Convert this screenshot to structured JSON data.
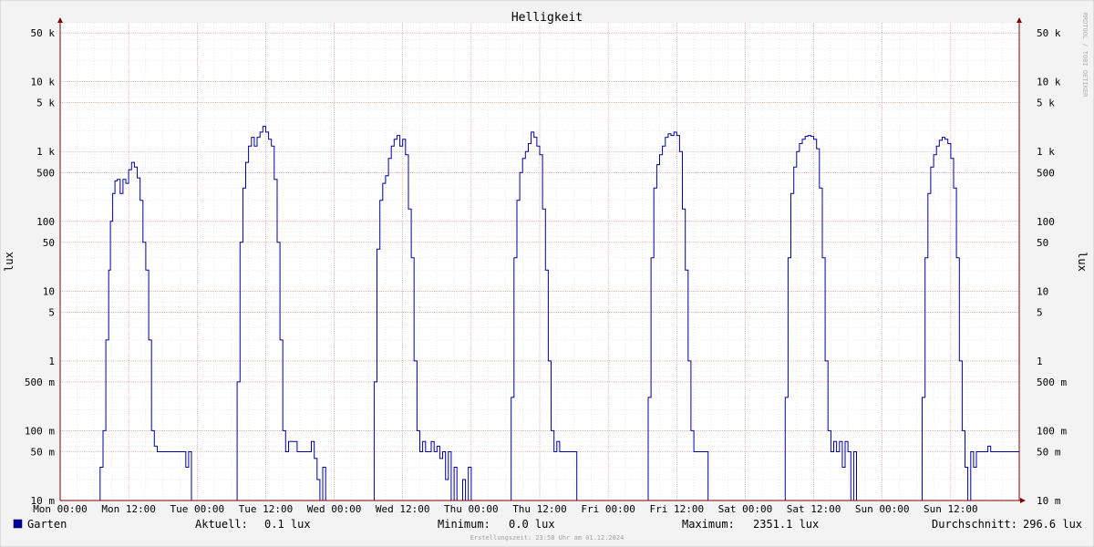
{
  "chart_data": {
    "type": "line",
    "title": "Helligkeit",
    "ylabel": "lux",
    "ylabel_right": "lux",
    "y_scale": "log",
    "ylim": [
      0.01,
      70000
    ],
    "y_ticks": [
      {
        "value": 0.01,
        "label": "10 m"
      },
      {
        "value": 0.05,
        "label": "50 m"
      },
      {
        "value": 0.1,
        "label": "100 m"
      },
      {
        "value": 0.5,
        "label": "500 m"
      },
      {
        "value": 1,
        "label": "1"
      },
      {
        "value": 5,
        "label": "5"
      },
      {
        "value": 10,
        "label": "10"
      },
      {
        "value": 50,
        "label": "50"
      },
      {
        "value": 100,
        "label": "100"
      },
      {
        "value": 500,
        "label": "500"
      },
      {
        "value": 1000,
        "label": "1 k"
      },
      {
        "value": 5000,
        "label": "5 k"
      },
      {
        "value": 10000,
        "label": "10 k"
      },
      {
        "value": 50000,
        "label": "50 k"
      }
    ],
    "x_ticks": [
      "Mon 00:00",
      "Mon 12:00",
      "Tue 00:00",
      "Tue 12:00",
      "Wed 00:00",
      "Wed 12:00",
      "Thu 00:00",
      "Thu 12:00",
      "Fri 00:00",
      "Fri 12:00",
      "Sat 00:00",
      "Sat 12:00",
      "Sun 00:00",
      "Sun 12:00"
    ],
    "x_unit": "hours since Mon 00:00",
    "xlim": [
      0,
      168
    ],
    "grid": true,
    "series": [
      {
        "name": "Garten",
        "color": "#0000a0",
        "points": [
          [
            0,
            0.01
          ],
          [
            6.5,
            0.01
          ],
          [
            7,
            0.03
          ],
          [
            7.5,
            0.1
          ],
          [
            8,
            2
          ],
          [
            8.5,
            20
          ],
          [
            8.8,
            100
          ],
          [
            9.2,
            250
          ],
          [
            9.6,
            380
          ],
          [
            10,
            400
          ],
          [
            10.5,
            250
          ],
          [
            11,
            400
          ],
          [
            11.5,
            350
          ],
          [
            12,
            550
          ],
          [
            12.5,
            700
          ],
          [
            13,
            600
          ],
          [
            13.5,
            420
          ],
          [
            14,
            200
          ],
          [
            14.5,
            50
          ],
          [
            15,
            20
          ],
          [
            15.5,
            2
          ],
          [
            16,
            0.1
          ],
          [
            16.5,
            0.06
          ],
          [
            17,
            0.05
          ],
          [
            18,
            0.05
          ],
          [
            19,
            0.05
          ],
          [
            20,
            0.05
          ],
          [
            21.5,
            0.05
          ],
          [
            22,
            0.03
          ],
          [
            22.5,
            0.05
          ],
          [
            23,
            0.01
          ],
          [
            24,
            0.01
          ],
          [
            30.5,
            0.01
          ],
          [
            31,
            0.5
          ],
          [
            31.5,
            50
          ],
          [
            32,
            300
          ],
          [
            32.5,
            700
          ],
          [
            33,
            1200
          ],
          [
            33.5,
            1600
          ],
          [
            34,
            1200
          ],
          [
            34.5,
            1600
          ],
          [
            35,
            1900
          ],
          [
            35.5,
            2300
          ],
          [
            36,
            1900
          ],
          [
            36.5,
            1500
          ],
          [
            37,
            1200
          ],
          [
            37.5,
            400
          ],
          [
            38,
            50
          ],
          [
            38.5,
            2
          ],
          [
            39,
            0.1
          ],
          [
            39.5,
            0.05
          ],
          [
            40,
            0.07
          ],
          [
            41,
            0.07
          ],
          [
            41.5,
            0.05
          ],
          [
            43,
            0.05
          ],
          [
            44,
            0.07
          ],
          [
            44.5,
            0.04
          ],
          [
            45,
            0.02
          ],
          [
            45.5,
            0.01
          ],
          [
            46,
            0.03
          ],
          [
            46.5,
            0.01
          ],
          [
            48,
            0.01
          ],
          [
            54.5,
            0.01
          ],
          [
            55,
            0.5
          ],
          [
            55.5,
            40
          ],
          [
            56,
            200
          ],
          [
            56.5,
            350
          ],
          [
            57,
            450
          ],
          [
            57.5,
            800
          ],
          [
            58,
            1200
          ],
          [
            58.5,
            1500
          ],
          [
            59,
            1700
          ],
          [
            59.5,
            1200
          ],
          [
            60,
            1500
          ],
          [
            60.5,
            900
          ],
          [
            61,
            150
          ],
          [
            61.5,
            30
          ],
          [
            62,
            1
          ],
          [
            62.5,
            0.1
          ],
          [
            63,
            0.05
          ],
          [
            63.5,
            0.07
          ],
          [
            64,
            0.05
          ],
          [
            65,
            0.07
          ],
          [
            65.5,
            0.05
          ],
          [
            66,
            0.06
          ],
          [
            66.5,
            0.04
          ],
          [
            67,
            0.05
          ],
          [
            67.5,
            0.02
          ],
          [
            68,
            0.05
          ],
          [
            68.5,
            0.01
          ],
          [
            69,
            0.03
          ],
          [
            69.5,
            0.01
          ],
          [
            70.5,
            0.02
          ],
          [
            71,
            0.01
          ],
          [
            71.5,
            0.03
          ],
          [
            72,
            0.01
          ],
          [
            78.5,
            0.01
          ],
          [
            79,
            0.3
          ],
          [
            79.5,
            30
          ],
          [
            80,
            200
          ],
          [
            80.5,
            500
          ],
          [
            81,
            800
          ],
          [
            81.5,
            1000
          ],
          [
            82,
            1300
          ],
          [
            82.5,
            1900
          ],
          [
            83,
            1600
          ],
          [
            83.5,
            1200
          ],
          [
            84,
            900
          ],
          [
            84.5,
            150
          ],
          [
            85,
            20
          ],
          [
            85.5,
            1
          ],
          [
            86,
            0.1
          ],
          [
            86.5,
            0.05
          ],
          [
            87,
            0.07
          ],
          [
            87.5,
            0.05
          ],
          [
            88,
            0.05
          ],
          [
            89,
            0.05
          ],
          [
            90,
            0.05
          ],
          [
            90.5,
            0.01
          ],
          [
            96,
            0.01
          ],
          [
            102.5,
            0.01
          ],
          [
            103,
            0.3
          ],
          [
            103.5,
            30
          ],
          [
            104,
            300
          ],
          [
            104.5,
            650
          ],
          [
            105,
            900
          ],
          [
            105.5,
            1200
          ],
          [
            106,
            1600
          ],
          [
            106.5,
            1800
          ],
          [
            107,
            1700
          ],
          [
            107.5,
            1900
          ],
          [
            108,
            1700
          ],
          [
            108.5,
            1000
          ],
          [
            109,
            150
          ],
          [
            109.5,
            20
          ],
          [
            110,
            1
          ],
          [
            110.5,
            0.1
          ],
          [
            111,
            0.05
          ],
          [
            112,
            0.05
          ],
          [
            113,
            0.05
          ],
          [
            113.5,
            0.01
          ],
          [
            120,
            0.01
          ],
          [
            126.5,
            0.01
          ],
          [
            127,
            0.3
          ],
          [
            127.5,
            30
          ],
          [
            128,
            250
          ],
          [
            128.5,
            600
          ],
          [
            129,
            1000
          ],
          [
            129.5,
            1300
          ],
          [
            130,
            1500
          ],
          [
            130.5,
            1650
          ],
          [
            131,
            1700
          ],
          [
            131.5,
            1650
          ],
          [
            132,
            1500
          ],
          [
            132.5,
            1100
          ],
          [
            133,
            300
          ],
          [
            133.5,
            30
          ],
          [
            134,
            1
          ],
          [
            134.5,
            0.1
          ],
          [
            135,
            0.05
          ],
          [
            135.5,
            0.07
          ],
          [
            136,
            0.05
          ],
          [
            136.5,
            0.07
          ],
          [
            137,
            0.03
          ],
          [
            137.5,
            0.07
          ],
          [
            138,
            0.05
          ],
          [
            138.5,
            0.01
          ],
          [
            139,
            0.05
          ],
          [
            139.5,
            0.01
          ],
          [
            144,
            0.01
          ],
          [
            150.5,
            0.01
          ],
          [
            151,
            0.3
          ],
          [
            151.5,
            30
          ],
          [
            152,
            250
          ],
          [
            152.5,
            600
          ],
          [
            153,
            900
          ],
          [
            153.5,
            1200
          ],
          [
            154,
            1450
          ],
          [
            154.5,
            1600
          ],
          [
            155,
            1500
          ],
          [
            155.5,
            1300
          ],
          [
            156,
            800
          ],
          [
            156.5,
            300
          ],
          [
            157,
            30
          ],
          [
            157.5,
            1
          ],
          [
            158,
            0.1
          ],
          [
            158.5,
            0.03
          ],
          [
            159,
            0.01
          ],
          [
            159.5,
            0.05
          ],
          [
            160,
            0.03
          ],
          [
            160.5,
            0.05
          ],
          [
            162,
            0.05
          ],
          [
            162.5,
            0.06
          ],
          [
            163,
            0.05
          ],
          [
            168,
            0.05
          ]
        ]
      }
    ],
    "legend": {
      "label": "Garten",
      "stats": [
        {
          "label": "Aktuell:",
          "value": "0.1 lux"
        },
        {
          "label": "Minimum:",
          "value": "0.0 lux"
        },
        {
          "label": "Maximum:",
          "value": "2351.1 lux"
        },
        {
          "label": "Durchschnitt:",
          "value": "296.6 lux"
        }
      ]
    },
    "footer": "Erstellungszeit: 23:58 Uhr am 01.12.2024",
    "watermark": "RRDTOOL / TOBI OETIKER"
  },
  "colors": {
    "background": "#f3f3f3",
    "plot_background": "#ffffff",
    "major_grid": "#e89090",
    "minor_grid": "#d8d8d8",
    "axis": "#800000",
    "series": "#0000a0"
  }
}
